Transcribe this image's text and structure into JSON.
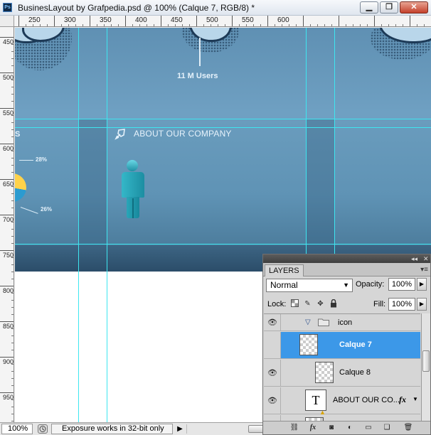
{
  "window": {
    "app_icon": "Ps",
    "title": "BusinesLayout by Grafpedia.psd @ 100% (Calque 7, RGB/8) *",
    "controls": {
      "minimize": "▁",
      "restore": "❐",
      "close": "✕"
    }
  },
  "ruler": {
    "top_ticks": [
      "250",
      "300",
      "350",
      "400",
      "450",
      "500",
      "550",
      "600"
    ],
    "left_ticks": [
      "450",
      "500",
      "550",
      "600",
      "650",
      "700",
      "750",
      "800",
      "850",
      "900",
      "950"
    ]
  },
  "canvas": {
    "users_label": "11 M Users",
    "about_label": "ABOUT OUR COMPANY",
    "pct_top": "28%",
    "pct_bottom": "26%",
    "edge_letter": "S",
    "colors": {
      "background": "#6a9cbd",
      "guide": "#3ee6f0",
      "figure": "#1f9fb3"
    }
  },
  "statusbar": {
    "zoom": "100%",
    "message": "Exposure works in 32-bit only",
    "arrow": "▶"
  },
  "layers_panel": {
    "collapse_glyph": "◂◂",
    "close_glyph": "✕",
    "tab": "LAYERS",
    "menu_icon": "▾≡",
    "blend_mode": "Normal",
    "opacity_label": "Opacity:",
    "opacity_value": "100%",
    "lock_label": "Lock:",
    "fill_label": "Fill:",
    "fill_value": "100%",
    "layers": [
      {
        "name": "icon",
        "type": "group",
        "expanded": true
      },
      {
        "name": "Calque 7",
        "type": "pixel",
        "selected": true
      },
      {
        "name": "Calque 8",
        "type": "pixel",
        "selected": false
      },
      {
        "name": "ABOUT OUR CO...",
        "type": "text",
        "fx": "fx"
      }
    ],
    "text_thumb_glyph": "T",
    "accent_color": "#3c98e8"
  }
}
